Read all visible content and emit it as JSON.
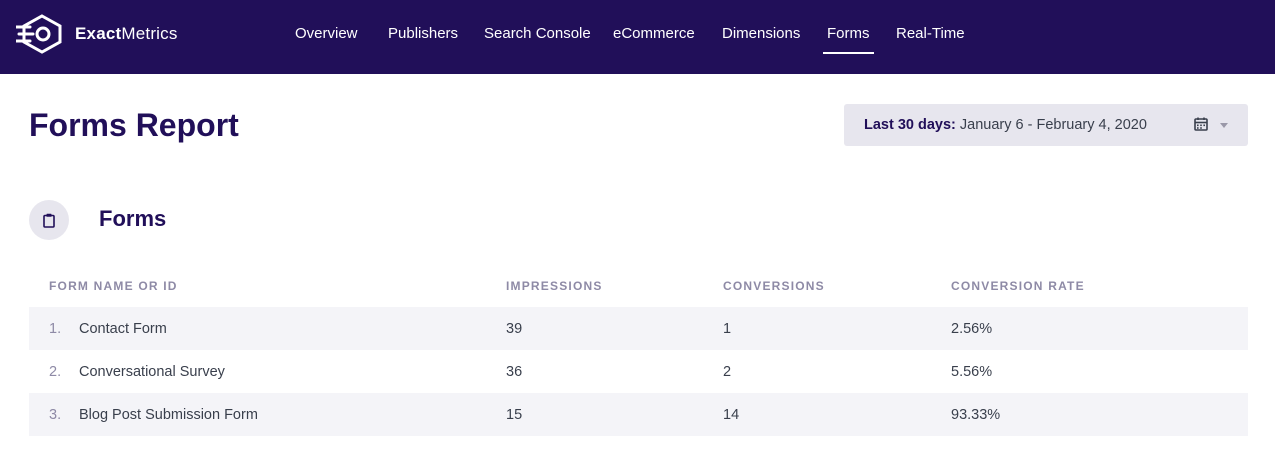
{
  "brand": {
    "name_bold": "Exact",
    "name_regular": "Metrics"
  },
  "nav": {
    "items": [
      {
        "label": "Overview"
      },
      {
        "label": "Publishers"
      },
      {
        "label": "Search Console"
      },
      {
        "label": "eCommerce"
      },
      {
        "label": "Dimensions"
      },
      {
        "label": "Forms"
      },
      {
        "label": "Real-Time"
      }
    ],
    "active": "Forms"
  },
  "page": {
    "title": "Forms Report"
  },
  "date_range": {
    "label": "Last 30 days:",
    "value": "January 6 - February 4, 2020",
    "icon": "calendar-icon"
  },
  "section": {
    "title": "Forms",
    "icon": "clipboard-icon"
  },
  "table": {
    "headers": [
      "FORM NAME OR ID",
      "IMPRESSIONS",
      "CONVERSIONS",
      "CONVERSION RATE"
    ],
    "rows": [
      {
        "index": "1.",
        "name": "Contact Form",
        "impressions": "39",
        "conversions": "1",
        "rate": "2.56%"
      },
      {
        "index": "2.",
        "name": "Conversational Survey",
        "impressions": "36",
        "conversions": "2",
        "rate": "5.56%"
      },
      {
        "index": "3.",
        "name": "Blog Post Submission Form",
        "impressions": "15",
        "conversions": "14",
        "rate": "93.33%"
      }
    ]
  },
  "colors": {
    "header_bg": "#210f59",
    "accent": "#210f59",
    "muted": "#8e8aa6",
    "row_shade": "#f4f4f8"
  }
}
